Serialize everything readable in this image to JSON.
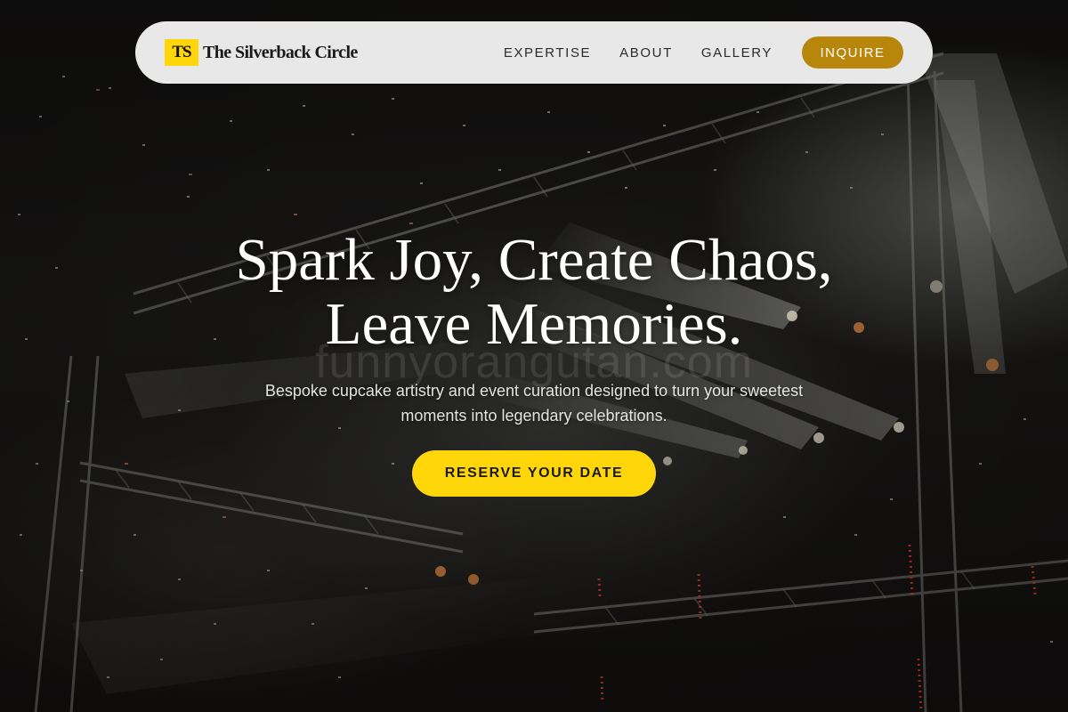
{
  "brand": {
    "logo_initials": "TS",
    "name": "The Silverback Circle"
  },
  "nav": {
    "links": [
      "EXPERTISE",
      "ABOUT",
      "GALLERY"
    ],
    "cta_label": "INQUIRE"
  },
  "hero": {
    "title_line1": "Spark Joy, Create Chaos,",
    "title_line2": "Leave Memories.",
    "watermark": "funnyorangutan.com",
    "subtitle": "Bespoke cupcake artistry and event curation designed to turn your sweetest moments into legendary celebrations.",
    "cta_label": "RESERVE YOUR DATE",
    "background_image": "concert-stage-with-light-beams-and-confetti"
  },
  "colors": {
    "accent_yellow": "#ffd60a",
    "accent_gold": "#b8860b",
    "nav_background": "#e8e8e8",
    "hero_text": "#ffffff"
  }
}
